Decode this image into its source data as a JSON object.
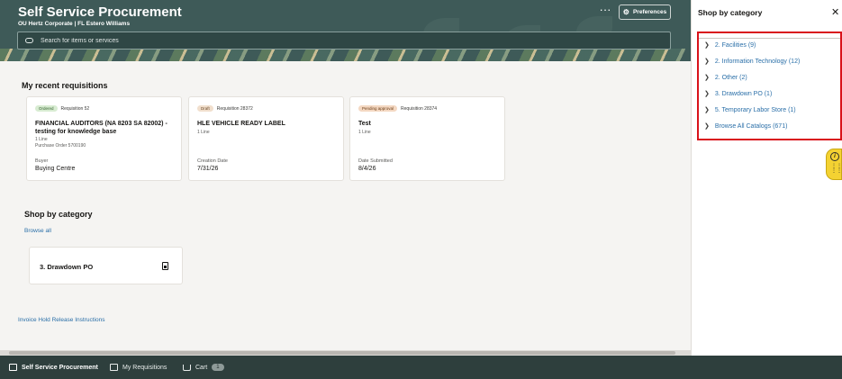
{
  "header": {
    "title": "Self Service Procurement",
    "subtitle": "OU Hertz Corporate | FL Estero Williams",
    "preferences_label": "Preferences",
    "search_placeholder": "Search for items or services"
  },
  "recent": {
    "title": "My recent requisitions",
    "cards": [
      {
        "status": "Ordered",
        "number": "Requisition 52",
        "title": "FINANCIAL AUDITORS (NA 8203 SA 82002) - testing for knowledge base",
        "lines": "1 Line",
        "po": "Purchase Order 5700190",
        "meta_label": "Buyer",
        "meta_value": "Buying Centre"
      },
      {
        "status": "Draft",
        "number": "Requisition 28372",
        "title": "HLE VEHICLE READY LABEL",
        "lines": "1 Line",
        "meta_label": "Creation Date",
        "meta_value": "7/31/26"
      },
      {
        "status": "Pending approval",
        "number": "Requisition 28374",
        "title": "Test",
        "lines": "1 Line",
        "meta_label": "Date Submitted",
        "meta_value": "8/4/26"
      }
    ]
  },
  "shop": {
    "title": "Shop by category",
    "browse_all": "Browse all",
    "card_label": "3. Drawdown PO"
  },
  "invoice_link": "Invoice Hold Release Instructions",
  "bottom_nav": {
    "item1": "Self Service Procurement",
    "item2": "My Requisitions",
    "item3": "Cart",
    "cart_count": "1"
  },
  "panel": {
    "title": "Shop by category",
    "categories": [
      "2. Facilities (9)",
      "2. Information Technology (12)",
      "2. Other (2)",
      "3. Drawdown PO (1)",
      "5. Temporary Labor Store (1)",
      "Browse All Catalogs (671)"
    ]
  },
  "colors": {
    "header_bg": "#3e5a58",
    "link": "#2a6fa8",
    "highlight_border": "#d9121a",
    "bottom_nav_bg": "#2e3f3d"
  }
}
